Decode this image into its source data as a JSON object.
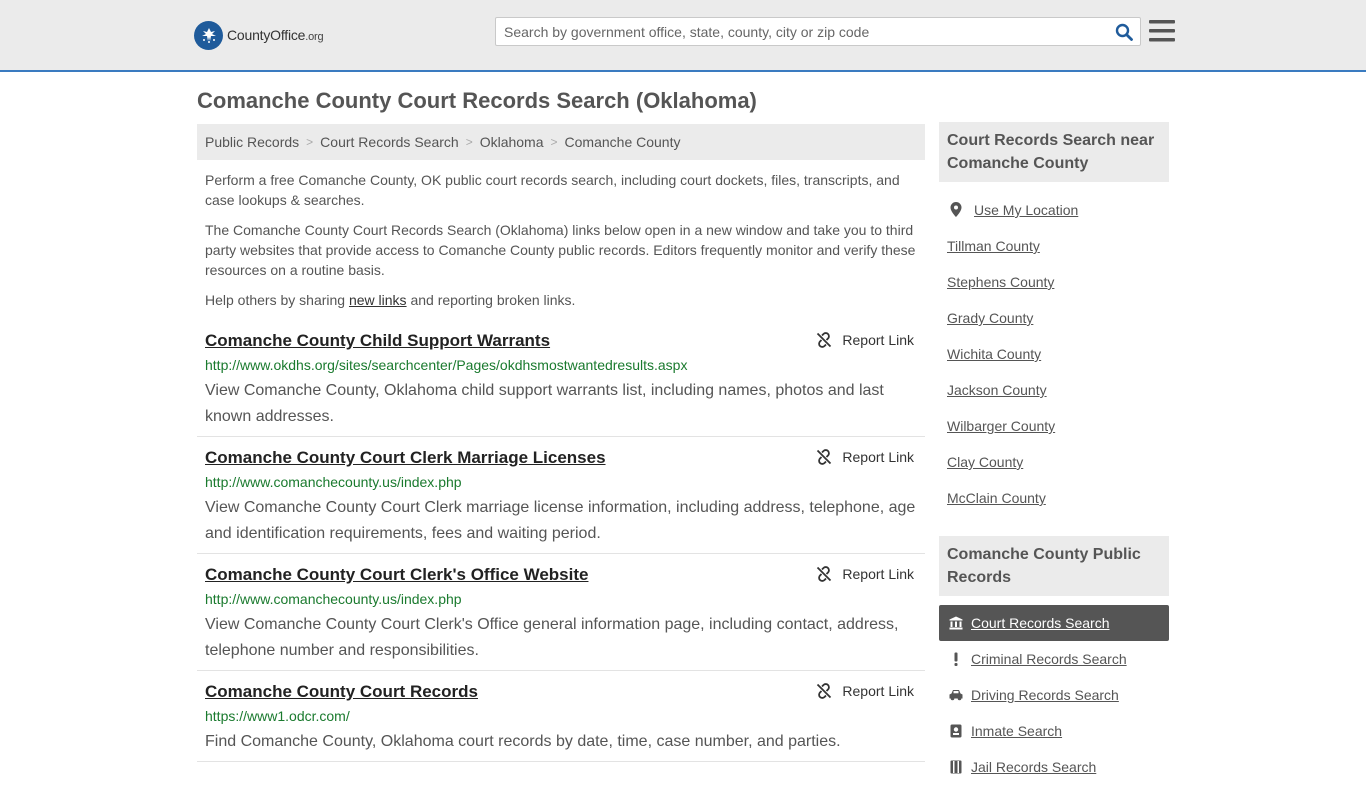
{
  "header": {
    "logo_name": "CountyOffice",
    "logo_tld": ".org",
    "search_placeholder": "Search by government office, state, county, city or zip code"
  },
  "page": {
    "title": "Comanche County Court Records Search (Oklahoma)"
  },
  "breadcrumb": [
    "Public Records",
    "Court Records Search",
    "Oklahoma",
    "Comanche County"
  ],
  "intro": {
    "p1": "Perform a free Comanche County, OK public court records search, including court dockets, files, transcripts, and case lookups & searches.",
    "p2": "The Comanche County Court Records Search (Oklahoma) links below open in a new window and take you to third party websites that provide access to Comanche County public records. Editors frequently monitor and verify these resources on a routine basis.",
    "p3_before": "Help others by sharing ",
    "p3_link": "new links",
    "p3_after": " and reporting broken links."
  },
  "report_label": "Report Link",
  "results": [
    {
      "title": "Comanche County Child Support Warrants",
      "url": "http://www.okdhs.org/sites/searchcenter/Pages/okdhsmostwantedresults.aspx",
      "desc": "View Comanche County, Oklahoma child support warrants list, including names, photos and last known addresses."
    },
    {
      "title": "Comanche County Court Clerk Marriage Licenses",
      "url": "http://www.comanchecounty.us/index.php",
      "desc": "View Comanche County Court Clerk marriage license information, including address, telephone, age and identification requirements, fees and waiting period."
    },
    {
      "title": "Comanche County Court Clerk's Office Website",
      "url": "http://www.comanchecounty.us/index.php",
      "desc": "View Comanche County Court Clerk's Office general information page, including contact, address, telephone number and responsibilities."
    },
    {
      "title": "Comanche County Court Records",
      "url": "https://www1.odcr.com/",
      "desc": "Find Comanche County, Oklahoma court records by date, time, case number, and parties."
    }
  ],
  "sidebar": {
    "nearby_heading": "Court Records Search near Comanche County",
    "use_location": "Use My Location",
    "nearby": [
      "Tillman County",
      "Stephens County",
      "Grady County",
      "Wichita County",
      "Jackson County",
      "Wilbarger County",
      "Clay County",
      "McClain County"
    ],
    "public_heading": "Comanche County Public Records",
    "public_items": [
      {
        "label": "Court Records Search",
        "icon": "courthouse-icon",
        "active": true
      },
      {
        "label": "Criminal Records Search",
        "icon": "exclamation-icon",
        "active": false
      },
      {
        "label": "Driving Records Search",
        "icon": "car-icon",
        "active": false
      },
      {
        "label": "Inmate Search",
        "icon": "id-badge-icon",
        "active": false
      },
      {
        "label": "Jail Records Search",
        "icon": "jail-icon",
        "active": false
      }
    ]
  },
  "colors": {
    "header_bg": "#ebebeb",
    "header_border": "#3a7bc0",
    "logo_blue": "#1f5b9b",
    "search_icon": "#1f5b9b",
    "url_green": "#1a7a2e",
    "active_item_bg": "#555555"
  }
}
